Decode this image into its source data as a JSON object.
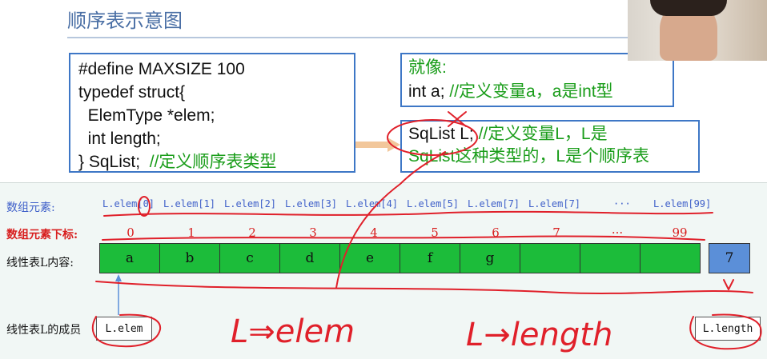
{
  "slide": {
    "title": "顺序表示意图",
    "code_lines": [
      "#define MAXSIZE 100",
      "typedef struct{",
      "  ElemType *elem;",
      "  int length;"
    ],
    "code_last_prefix": "} SqList;",
    "code_last_comment": "//定义顺序表类型",
    "like_heading": "就像:",
    "like_code": "int a;",
    "like_comment": "//定义变量a，a是int型",
    "sqlist_code": "SqList L;",
    "sqlist_comment_1": "//定义变量L，L是",
    "sqlist_comment_2": "SqList这种类型的，L是个顺序表"
  },
  "diagram": {
    "label_elements": "数组元素:",
    "label_indices": "数组元素下标:",
    "label_contents": "线性表L内容:",
    "label_members": "线性表L的成员",
    "element_names": [
      "L.elem[0]",
      "L.elem[1]",
      "L.elem[2]",
      "L.elem[3]",
      "L.elem[4]",
      "L.elem[5]",
      "L.elem[7]",
      "L.elem[7]",
      "···",
      "L.elem[99]"
    ],
    "indices": [
      "0",
      "1",
      "2",
      "3",
      "4",
      "5",
      "6",
      "7",
      "···",
      "99"
    ],
    "cells": [
      "a",
      "b",
      "c",
      "d",
      "e",
      "f",
      "g",
      "",
      "",
      ""
    ],
    "length_value": "7",
    "member_elem": "L.elem",
    "member_length": "L.length"
  },
  "handwriting": {
    "note_elem": "L⇒elem",
    "note_length": "L→length"
  },
  "colors": {
    "accent_blue": "#3e77c6",
    "cell_green": "#1cbc3a",
    "length_blue": "#5b8fd8",
    "index_red": "#d81e1e",
    "ink_red": "#e0202a",
    "comment_green": "#1a9d1a"
  }
}
